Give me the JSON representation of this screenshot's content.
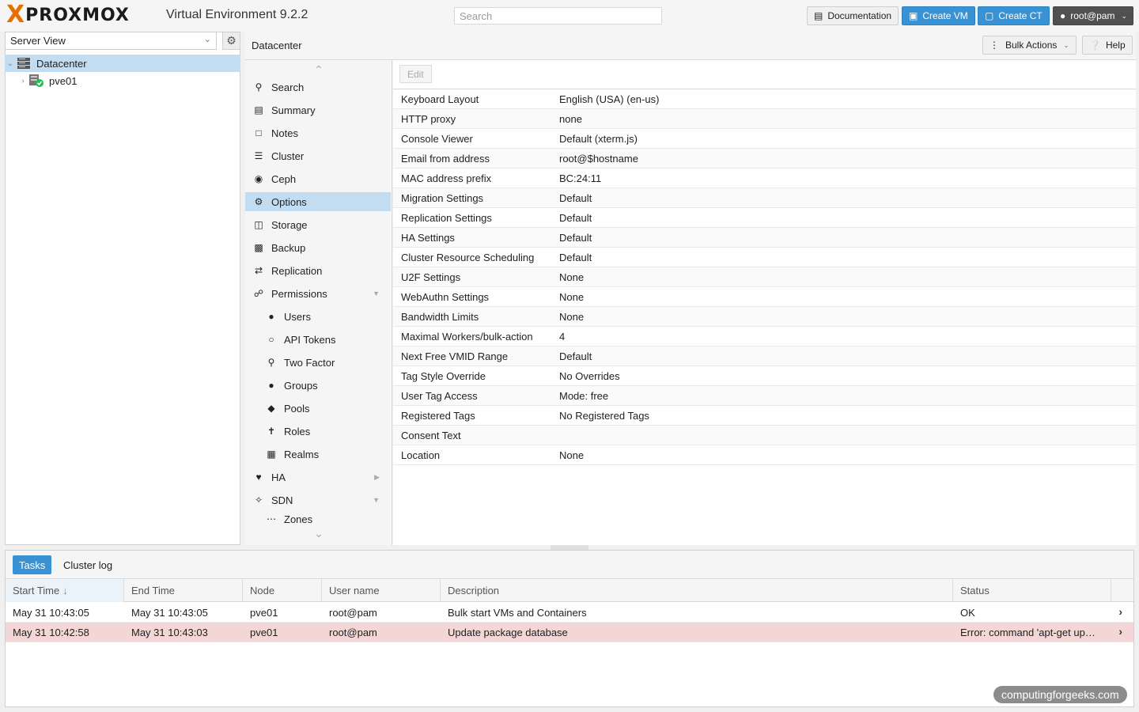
{
  "header": {
    "logo_x": "X",
    "logo_text": "PROXMOX",
    "version": "Virtual Environment 9.2.2",
    "search_placeholder": "Search",
    "documentation_label": "Documentation",
    "create_vm_label": "Create VM",
    "create_ct_label": "Create CT",
    "user_label": "root@pam"
  },
  "sidebar": {
    "view": "Server View",
    "tree": [
      {
        "label": "Datacenter",
        "icon": "server-rack-icon",
        "selected": true
      },
      {
        "label": "pve01",
        "icon": "node-online-icon",
        "selected": false
      }
    ]
  },
  "content": {
    "title": "Datacenter",
    "bulk_actions_label": "Bulk Actions",
    "help_label": "Help",
    "edit_label": "Edit"
  },
  "nav": [
    {
      "label": "Search",
      "icon": "search-icon"
    },
    {
      "label": "Summary",
      "icon": "book-icon"
    },
    {
      "label": "Notes",
      "icon": "sticky-note-icon"
    },
    {
      "label": "Cluster",
      "icon": "server-icon"
    },
    {
      "label": "Ceph",
      "icon": "ceph-icon"
    },
    {
      "label": "Options",
      "icon": "gear-icon",
      "active": true
    },
    {
      "label": "Storage",
      "icon": "database-icon"
    },
    {
      "label": "Backup",
      "icon": "floppy-icon"
    },
    {
      "label": "Replication",
      "icon": "retweet-icon"
    },
    {
      "label": "Permissions",
      "icon": "unlock-icon",
      "expanded": true
    },
    {
      "label": "Users",
      "icon": "user-icon"
    },
    {
      "label": "API Tokens",
      "icon": "user-outline-icon"
    },
    {
      "label": "Two Factor",
      "icon": "key-icon"
    },
    {
      "label": "Groups",
      "icon": "users-icon"
    },
    {
      "label": "Pools",
      "icon": "tags-icon"
    },
    {
      "label": "Roles",
      "icon": "male-icon"
    },
    {
      "label": "Realms",
      "icon": "address-book-icon"
    },
    {
      "label": "HA",
      "icon": "heartbeat-icon",
      "expanded": false
    },
    {
      "label": "SDN",
      "icon": "sdn-icon",
      "expanded": true
    },
    {
      "label": "Zones",
      "icon": "ellipsis-icon"
    }
  ],
  "options": [
    {
      "key": "Keyboard Layout",
      "value": "English (USA) (en-us)"
    },
    {
      "key": "HTTP proxy",
      "value": "none"
    },
    {
      "key": "Console Viewer",
      "value": "Default (xterm.js)"
    },
    {
      "key": "Email from address",
      "value": "root@$hostname"
    },
    {
      "key": "MAC address prefix",
      "value": "BC:24:11"
    },
    {
      "key": "Migration Settings",
      "value": "Default"
    },
    {
      "key": "Replication Settings",
      "value": "Default"
    },
    {
      "key": "HA Settings",
      "value": "Default"
    },
    {
      "key": "Cluster Resource Scheduling",
      "value": "Default"
    },
    {
      "key": "U2F Settings",
      "value": "None"
    },
    {
      "key": "WebAuthn Settings",
      "value": "None"
    },
    {
      "key": "Bandwidth Limits",
      "value": "None"
    },
    {
      "key": "Maximal Workers/bulk-action",
      "value": "4"
    },
    {
      "key": "Next Free VMID Range",
      "value": "Default"
    },
    {
      "key": "Tag Style Override",
      "value": "No Overrides"
    },
    {
      "key": "User Tag Access",
      "value": "Mode: free"
    },
    {
      "key": "Registered Tags",
      "value": "No Registered Tags"
    },
    {
      "key": "Consent Text",
      "value": ""
    },
    {
      "key": "Location",
      "value": "None"
    }
  ],
  "tasks": {
    "tabs": [
      "Tasks",
      "Cluster log"
    ],
    "columns": [
      "Start Time",
      "End Time",
      "Node",
      "User name",
      "Description",
      "Status"
    ],
    "rows": [
      {
        "start": "May 31 10:43:05",
        "end": "May 31 10:43:05",
        "node": "pve01",
        "user": "root@pam",
        "description": "Bulk start VMs and Containers",
        "status": "OK",
        "error": false
      },
      {
        "start": "May 31 10:42:58",
        "end": "May 31 10:43:03",
        "node": "pve01",
        "user": "root@pam",
        "description": "Update package database",
        "status": "Error: command 'apt-get up…",
        "error": true
      }
    ]
  },
  "watermark": "computingforgeeks.com",
  "colors": {
    "accent": "#3892d3",
    "brand_orange": "#e57000",
    "selected": "#c2ddf2",
    "error_row": "#f3d6d7"
  }
}
